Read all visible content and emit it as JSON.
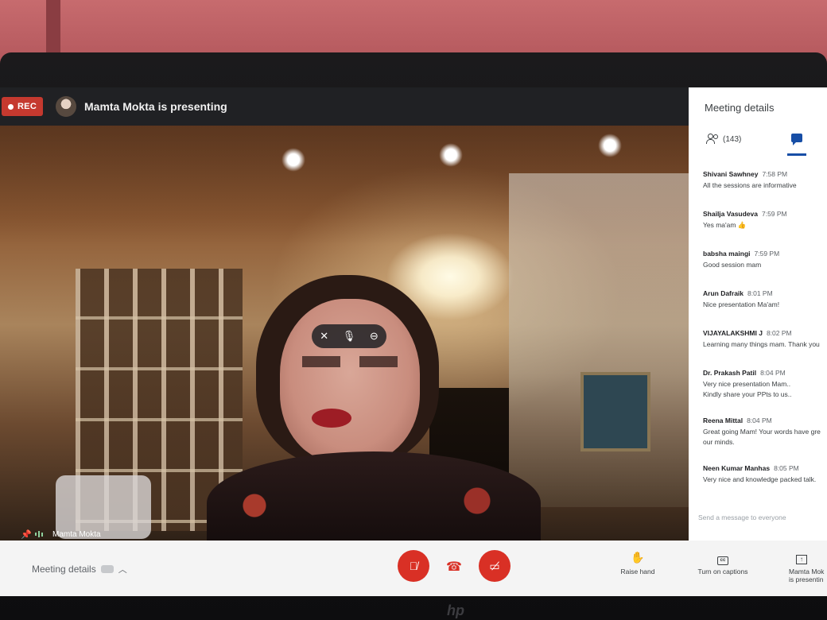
{
  "recording": {
    "label": "REC"
  },
  "presenter": {
    "status_text": "Mamta Mokta is presenting"
  },
  "video": {
    "participant_name": "Mamta Mokta"
  },
  "panel": {
    "title": "Meeting details",
    "people_count": "(143)",
    "messages": [
      {
        "sender": "Shivani Sawhney",
        "time": "7:58 PM",
        "text": "All the sessions are informative"
      },
      {
        "sender": "Shailja Vasudeva",
        "time": "7:59 PM",
        "text": "Yes ma'am 👍"
      },
      {
        "sender": "babsha maingi",
        "time": "7:59 PM",
        "text": "Good session mam"
      },
      {
        "sender": "Arun Dafraik",
        "time": "8:01 PM",
        "text": "Nice presentation Ma'am!"
      },
      {
        "sender": "VIJAYALAKSHMI J",
        "time": "8:02 PM",
        "text": "Learning many things mam. Thank you"
      },
      {
        "sender": "Dr. Prakash Patil",
        "time": "8:04 PM",
        "text": "Very nice presentation Mam..\nKindly share your PPts to us.."
      },
      {
        "sender": "Reena Mittal",
        "time": "8:04 PM",
        "text": "Great going Mam! Your words have gre\nour minds."
      },
      {
        "sender": "Neen Kumar Manhas",
        "time": "8:05 PM",
        "text": "Very nice and knowledge packed talk."
      }
    ],
    "input_placeholder": "Send a message to everyone"
  },
  "bottombar": {
    "details_label": "Meeting details",
    "raise_hand_label": "Raise hand",
    "captions_label": "Turn on captions",
    "present_label": "Mamta Mok\nis presentin"
  },
  "icons": {
    "mic_off": "mic-off-icon",
    "hang_up": "phone-hangup-icon",
    "cam_off": "camera-off-icon",
    "raise_hand": "hand-icon",
    "captions": "cc-icon",
    "present": "present-screen-icon"
  },
  "colors": {
    "rec_red": "#c5392f",
    "control_red": "#d93025",
    "chat_blue": "#174ea6",
    "topbar": "#202124"
  }
}
